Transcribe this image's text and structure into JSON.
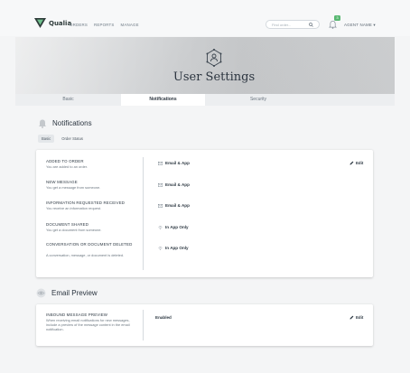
{
  "nav": {
    "brand": "Qualia",
    "links": [
      "ORDERS",
      "REPORTS",
      "MANAGE"
    ],
    "search_placeholder": "Find order...",
    "notification_count": "3",
    "agent_name": "AGENT NAME",
    "agent_chevron": "▾"
  },
  "hero": {
    "title": "User Settings",
    "icon": "settings-network-icon"
  },
  "tabs": [
    {
      "label": "Basic",
      "active": false
    },
    {
      "label": "Notifications",
      "active": true
    },
    {
      "label": "Security",
      "active": false
    }
  ],
  "notifications": {
    "title": "Notifications",
    "icon": "bell-icon",
    "subtabs": [
      {
        "label": "Basic",
        "active": true
      },
      {
        "label": "Order Status",
        "active": false
      }
    ],
    "edit_label": "Edit",
    "rows": [
      {
        "name": "ADDED TO ORDER",
        "desc": "You are added to an order.",
        "value": "Email & App",
        "value_icon": "envelope-icon"
      },
      {
        "name": "NEW MESSAGE",
        "desc": "You get a message from someone.",
        "value": "Email & App",
        "value_icon": "envelope-icon"
      },
      {
        "name": "INFORMATION REQUESTED RECEIVED",
        "desc": "You receive an information request.",
        "value": "Email & App",
        "value_icon": "envelope-icon"
      },
      {
        "name": "DOCUMENT SHARED",
        "desc": "You get a document from someone.",
        "value": "In App Only",
        "value_icon": "wifi-icon"
      },
      {
        "name": "CONVERSATION OR DOCUMENT DELETED",
        "desc": "A conversation, message, or document is deleted.",
        "value": "In App Only",
        "value_icon": "wifi-icon"
      }
    ]
  },
  "email_preview": {
    "title": "Email Preview",
    "icon": "eye-icon",
    "edit_label": "Edit",
    "row": {
      "name": "INBOUND MESSAGE PREVIEW",
      "desc": "When receiving email notifications for new messages, include a preview of the message content in the email notification.",
      "value": "Enabled"
    }
  },
  "colors": {
    "accent_green": "#59b872",
    "text_dark": "#2f3a44",
    "hero_gray": "#cfd1d3"
  }
}
